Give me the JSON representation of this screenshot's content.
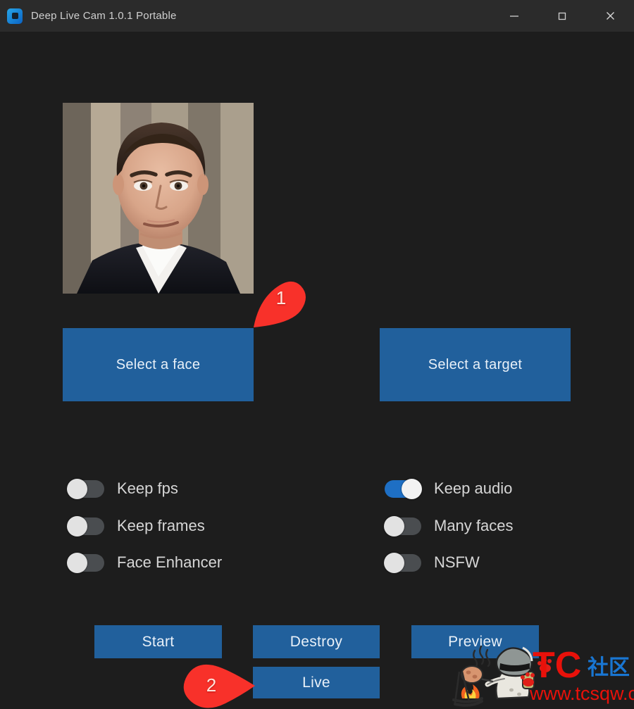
{
  "window": {
    "title": "Deep Live Cam 1.0.1 Portable",
    "icon": "app-logo-icon",
    "controls": {
      "minimize": "minimize-icon",
      "maximize": "maximize-icon",
      "close": "close-icon"
    },
    "background_color": "#1d1d1d",
    "titlebar_color": "#2b2b2b"
  },
  "colors": {
    "accent_button": "#21609c",
    "toggle_on": "#1e6fc4",
    "toggle_off": "#4a4d50",
    "marker_red": "#f8312a",
    "text": "#d6d6d6"
  },
  "preview": {
    "face_image_alt": "selected source face photo",
    "target_placeholder": ""
  },
  "selectors": {
    "select_face": "Select a face",
    "select_target": "Select a target"
  },
  "switches": {
    "left": [
      {
        "label": "Keep fps",
        "on": false
      },
      {
        "label": "Keep frames",
        "on": false
      },
      {
        "label": "Face Enhancer",
        "on": false
      }
    ],
    "right": [
      {
        "label": "Keep audio",
        "on": true
      },
      {
        "label": "Many faces",
        "on": false
      },
      {
        "label": "NSFW",
        "on": false
      }
    ]
  },
  "actions": {
    "start": "Start",
    "destroy": "Destroy",
    "preview": "Preview",
    "live": "Live"
  },
  "annotations": [
    {
      "number": "1",
      "points_at": "select-face-area"
    },
    {
      "number": "2",
      "points_at": "live-button"
    }
  ],
  "watermark": {
    "brand_latin": "TC",
    "brand_cjk": "社区",
    "url": "www.tcsqw.com",
    "mascot": "helmet-character-roasting-chicken-icon"
  }
}
